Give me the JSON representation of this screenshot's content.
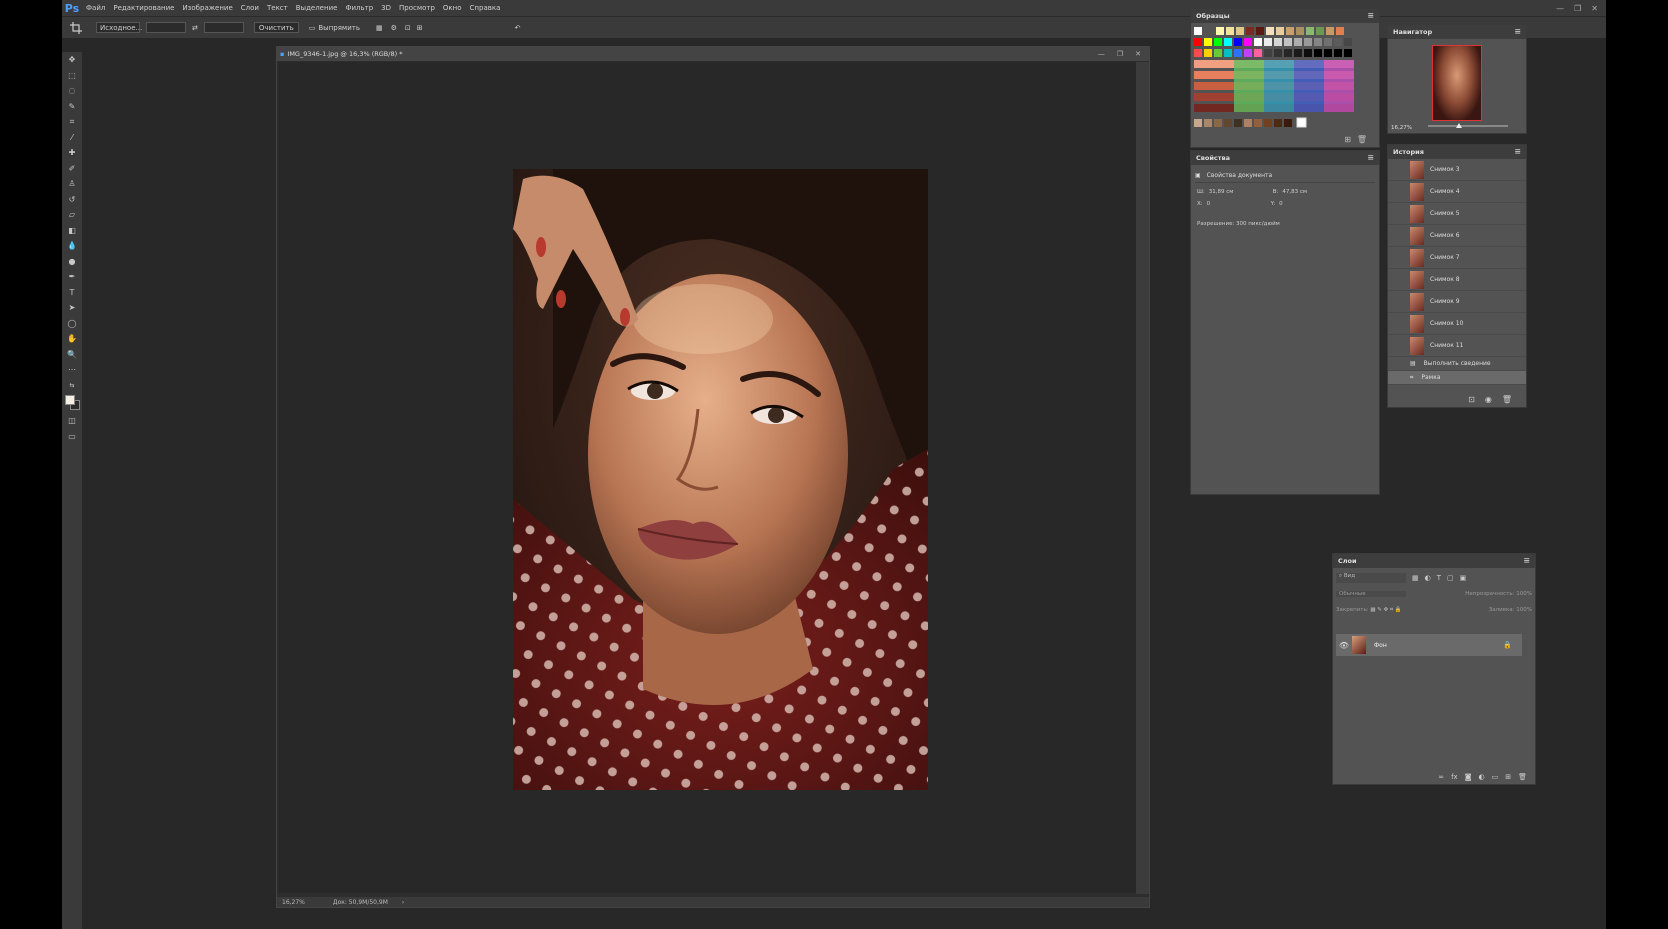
{
  "app": {
    "logo": "Ps",
    "menu": [
      "Файл",
      "Редактирование",
      "Изображение",
      "Слои",
      "Текст",
      "Выделение",
      "Фильтр",
      "3D",
      "Просмотр",
      "Окно",
      "Справка"
    ]
  },
  "options": {
    "ratio_label": "Исходное...",
    "clear_label": "Очистить",
    "straighten_label": "Выпрямить"
  },
  "document": {
    "title": "IMG_9346-1.jpg @ 16,3% (RGB/8) *",
    "zoom": "16,27%",
    "doc_size": "Док: 50,9M/50,9M"
  },
  "swatches_panel": {
    "title": "Образцы"
  },
  "properties_panel": {
    "title": "Свойства",
    "section": "Свойства документа",
    "w_label": "Ш:",
    "w_value": "31,89 см",
    "h_label": "В:",
    "h_value": "47,83 см",
    "x_label": "X:",
    "x_value": "0",
    "y_label": "Y:",
    "y_value": "0",
    "resolution": "Разрешение: 300 пикс/дюйм"
  },
  "navigator_panel": {
    "title": "Навигатор",
    "zoom": "16,27%"
  },
  "history_panel": {
    "title": "История",
    "items": [
      "Снимок 3",
      "Снимок 4",
      "Снимок 5",
      "Снимок 6",
      "Снимок 7",
      "Снимок 8",
      "Снимок 9",
      "Снимок 10",
      "Снимок 11",
      "Выполнить сведение",
      "Рамка"
    ]
  },
  "layers_panel": {
    "title": "Слои",
    "filter_placeholder": "Вид",
    "blend_mode": "Обычные",
    "opacity_label": "Непрозрачность:",
    "opacity_value": "100%",
    "lock_label": "Закрепить:",
    "fill_label": "Заливка:",
    "fill_value": "100%",
    "layer_name": "Фон"
  },
  "colors": {
    "ui_bg": "#282828",
    "panel_bg": "#535353",
    "accent": "#4da0ff"
  }
}
